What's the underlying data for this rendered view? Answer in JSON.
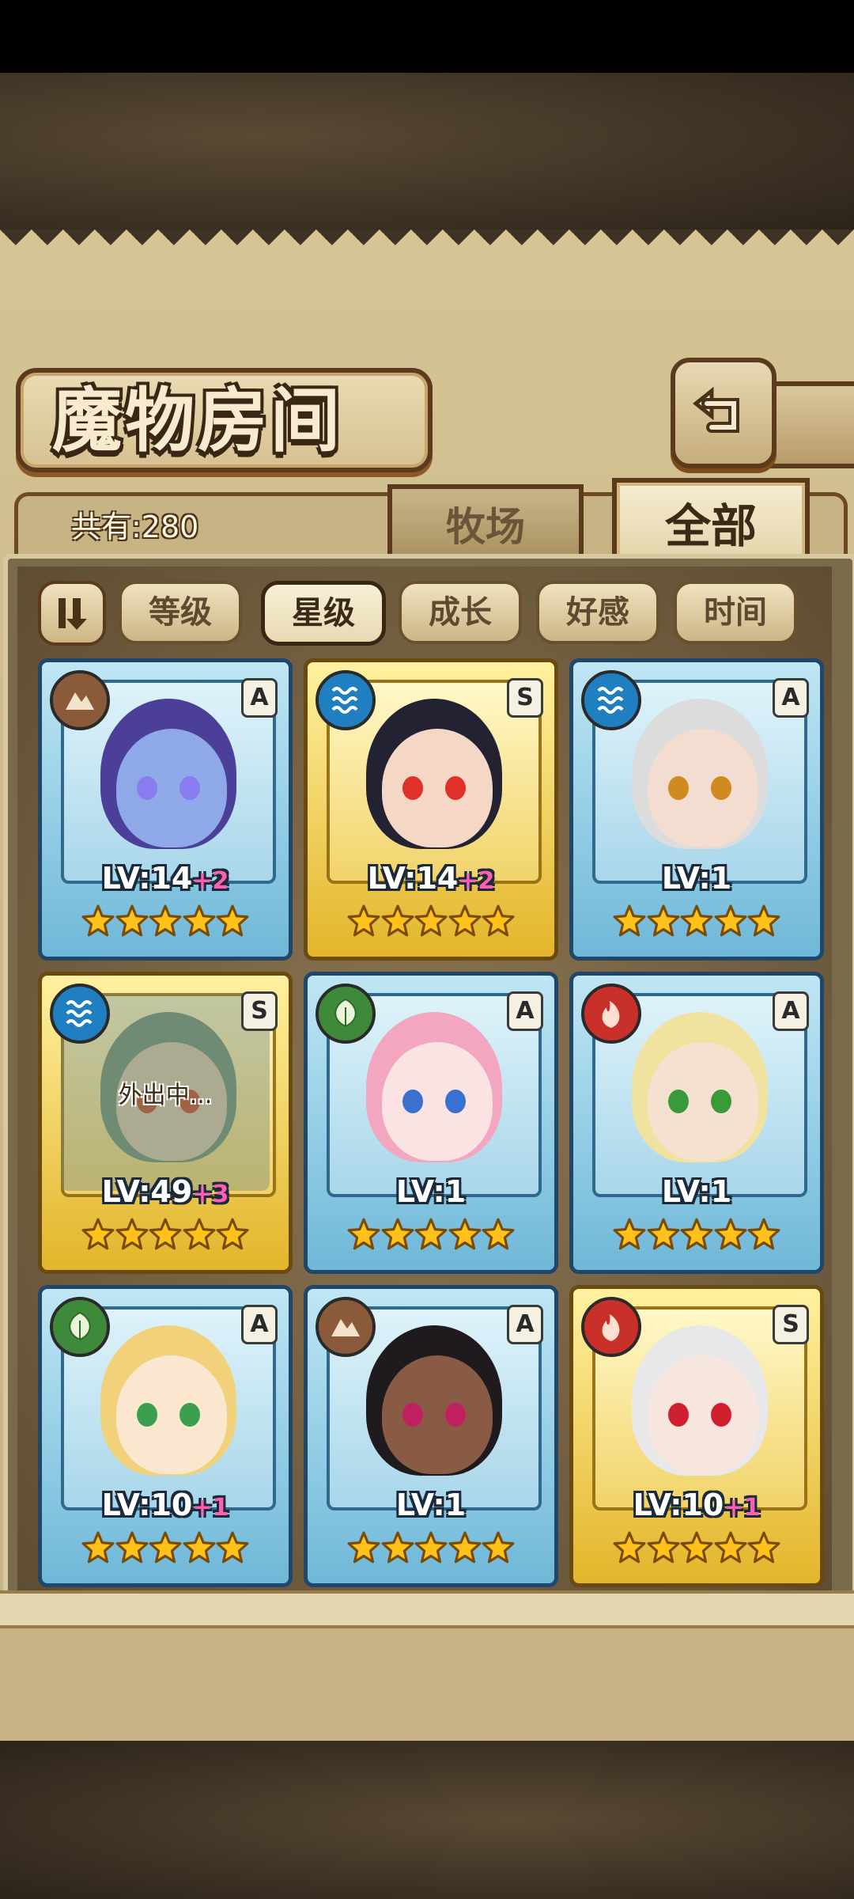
{
  "header": {
    "title": "魔物房间"
  },
  "summary": {
    "count": "共有:280"
  },
  "tabs": [
    {
      "label": "牧场",
      "active": false
    },
    {
      "label": "全部",
      "active": true
    }
  ],
  "sort": {
    "buttons": [
      {
        "label": "等级",
        "selected": false
      },
      {
        "label": "星级",
        "selected": true
      },
      {
        "label": "成长",
        "selected": false
      },
      {
        "label": "好感",
        "selected": false
      },
      {
        "label": "时间",
        "selected": false
      }
    ]
  },
  "colors": {
    "blue_frame": "#6fb8d8",
    "gold_frame": "#e3b52a",
    "plus": "#ff5fb0"
  },
  "cards": [
    {
      "element": "earth-icon",
      "rank": "A",
      "frame": "blue",
      "level": "LV:14",
      "plus": "+2",
      "status": "",
      "stars": 5
    },
    {
      "element": "water-icon",
      "rank": "S",
      "frame": "gold",
      "level": "LV:14",
      "plus": "+2",
      "status": "",
      "stars": 5
    },
    {
      "element": "water-icon",
      "rank": "A",
      "frame": "blue",
      "level": "LV:1",
      "plus": "",
      "status": "",
      "stars": 5
    },
    {
      "element": "water-icon",
      "rank": "S",
      "frame": "gold",
      "level": "LV:49",
      "plus": "+3",
      "status": "外出中...",
      "stars": 5
    },
    {
      "element": "wood-icon",
      "rank": "A",
      "frame": "blue",
      "level": "LV:1",
      "plus": "",
      "status": "",
      "stars": 5
    },
    {
      "element": "fire-icon",
      "rank": "A",
      "frame": "blue",
      "level": "LV:1",
      "plus": "",
      "status": "",
      "stars": 5
    },
    {
      "element": "wood-icon",
      "rank": "A",
      "frame": "blue",
      "level": "LV:10",
      "plus": "+1",
      "status": "",
      "stars": 5
    },
    {
      "element": "earth-icon",
      "rank": "A",
      "frame": "blue",
      "level": "LV:1",
      "plus": "",
      "status": "",
      "stars": 5
    },
    {
      "element": "fire-icon",
      "rank": "S",
      "frame": "gold",
      "level": "LV:10",
      "plus": "+1",
      "status": "",
      "stars": 5
    }
  ]
}
